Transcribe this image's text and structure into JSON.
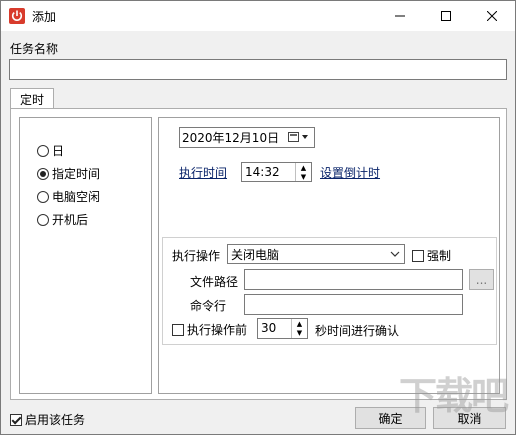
{
  "window": {
    "title": "添加"
  },
  "task_name": {
    "label": "任务名称",
    "value": ""
  },
  "tabs": [
    {
      "label": "定时"
    }
  ],
  "trigger_options": [
    {
      "label": "日",
      "checked": false
    },
    {
      "label": "指定时间",
      "checked": true
    },
    {
      "label": "电脑空闲",
      "checked": false
    },
    {
      "label": "开机后",
      "checked": false
    }
  ],
  "schedule": {
    "date": "2020年12月10日",
    "exec_time_label": "执行时间",
    "time": "14:32",
    "countdown_link": "设置倒计时"
  },
  "action": {
    "label": "执行操作",
    "selected": "关闭电脑",
    "force_label": "强制",
    "force_checked": false,
    "file_path_label": "文件路径",
    "file_path_value": "",
    "browse_label": "...",
    "command_label": "命令行",
    "command_value": "",
    "confirm_before_label": "执行操作前",
    "confirm_before_checked": false,
    "confirm_seconds": "30",
    "confirm_suffix": "秒时间进行确认"
  },
  "footer": {
    "enable_label": "启用该任务",
    "enable_checked": true,
    "ok_label": "确定",
    "cancel_label": "取消"
  },
  "watermark": "下载吧"
}
